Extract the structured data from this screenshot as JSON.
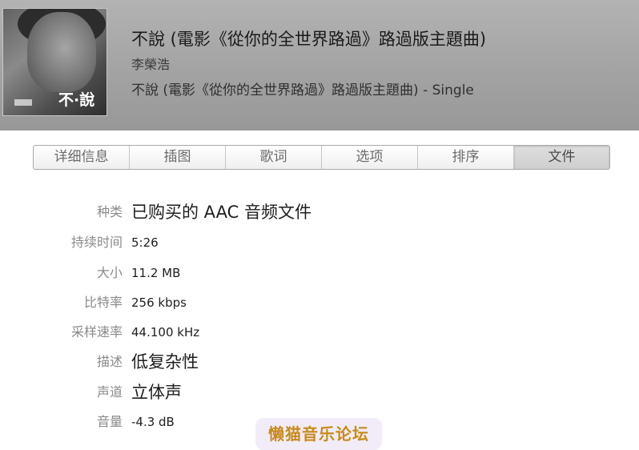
{
  "header": {
    "title": "不說 (電影《從你的全世界路過》路過版主題曲)",
    "artist": "李榮浩",
    "album": "不說 (電影《從你的全世界路過》路過版主題曲) - Single",
    "artwork_text": "不·說"
  },
  "tabs": [
    {
      "label": "详细信息",
      "active": false
    },
    {
      "label": "插图",
      "active": false
    },
    {
      "label": "歌词",
      "active": false
    },
    {
      "label": "选项",
      "active": false
    },
    {
      "label": "排序",
      "active": false
    },
    {
      "label": "文件",
      "active": true
    }
  ],
  "file_info": {
    "kind": {
      "label": "种类",
      "value": "已购买的 AAC 音频文件"
    },
    "duration": {
      "label": "持续时间",
      "value": "5:26"
    },
    "size": {
      "label": "大小",
      "value": "11.2 MB"
    },
    "bit_rate": {
      "label": "比特率",
      "value": "256 kbps"
    },
    "sample_rate": {
      "label": "采样速率",
      "value": "44.100 kHz"
    },
    "description": {
      "label": "描述",
      "value": "低复杂性"
    },
    "channels": {
      "label": "声道",
      "value": "立体声"
    },
    "volume": {
      "label": "音量",
      "value": "-4.3 dB"
    }
  },
  "watermark": "懒猫音乐论坛"
}
